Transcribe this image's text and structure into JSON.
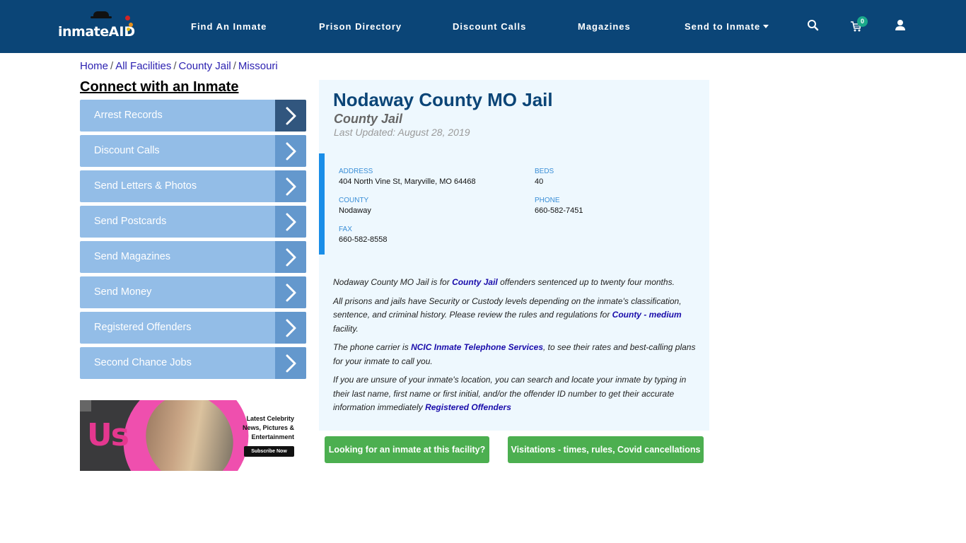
{
  "header": {
    "logo_text": "inmate",
    "logo_text_accent": "AID",
    "nav": [
      {
        "label": "Find An Inmate"
      },
      {
        "label": "Prison Directory"
      },
      {
        "label": "Discount Calls"
      },
      {
        "label": "Magazines"
      },
      {
        "label": "Send to Inmate",
        "has_dropdown": true
      }
    ],
    "icons": [
      "search-icon",
      "cart-icon",
      "user-icon"
    ],
    "cart_count": "0"
  },
  "breadcrumb": [
    {
      "label": "Home"
    },
    {
      "label": "All Facilities"
    },
    {
      "label": "County Jail"
    },
    {
      "label": "Missouri"
    }
  ],
  "breadcrumb_separator": "/",
  "sidebar": {
    "title": "Connect with an Inmate",
    "items": [
      {
        "label": "Arrest Records"
      },
      {
        "label": "Discount Calls"
      },
      {
        "label": "Send Letters & Photos"
      },
      {
        "label": "Send Postcards"
      },
      {
        "label": "Send Magazines"
      },
      {
        "label": "Send Money"
      },
      {
        "label": "Registered Offenders"
      },
      {
        "label": "Second Chance Jobs"
      }
    ]
  },
  "ad": {
    "brand": "Us",
    "line1": "Latest Celebrity",
    "line2": "News, Pictures &",
    "line3": "Entertainment",
    "cta": "Subscribe Now"
  },
  "facility": {
    "name": "Nodaway County MO Jail",
    "type": "County Jail",
    "last_updated": "Last Updated: August 28, 2019",
    "fields": {
      "address": {
        "label": "ADDRESS",
        "value": "404 North Vine St, Maryville, MO 64468"
      },
      "beds": {
        "label": "BEDS",
        "value": "40"
      },
      "county": {
        "label": "COUNTY",
        "value": "Nodaway"
      },
      "phone": {
        "label": "PHONE",
        "value": "660-582-7451"
      },
      "fax": {
        "label": "FAX",
        "value": "660-582-8558"
      }
    }
  },
  "description": {
    "p1_a": "Nodaway County MO Jail is for ",
    "p1_link": "County Jail",
    "p1_b": " offenders sentenced up to twenty four months.",
    "p2_a": "All prisons and jails have Security or Custody levels depending on the inmate's classification, sentence, and criminal history. Please review the rules and regulations for ",
    "p2_link": "County - medium",
    "p2_b": " facility.",
    "p3_a": "The phone carrier is ",
    "p3_link": "NCIC Inmate Telephone Services",
    "p3_b": ", to see their rates and best-calling plans for your inmate to call you.",
    "p4_a": "If you are unsure of your inmate's location, you can search and locate your inmate by typing in their last name, first name or first initial, and/or the offender ID number to get their accurate information immediately ",
    "p4_link": "Registered Offenders"
  },
  "buttons": {
    "find_inmate": "Looking for an inmate at this facility?",
    "visitations": "Visitations - times, rules, Covid cancellations"
  },
  "colors": {
    "header_bg": "#0b4577",
    "sidebar_item": "#93bde7",
    "sidebar_arrow": "#6498cd",
    "sidebar_arrow_active": "#31567e",
    "panel_bg": "#eef8fe",
    "accent_bar": "#1a8ee8",
    "button_green": "#4caf50",
    "link": "#1a0dab"
  }
}
